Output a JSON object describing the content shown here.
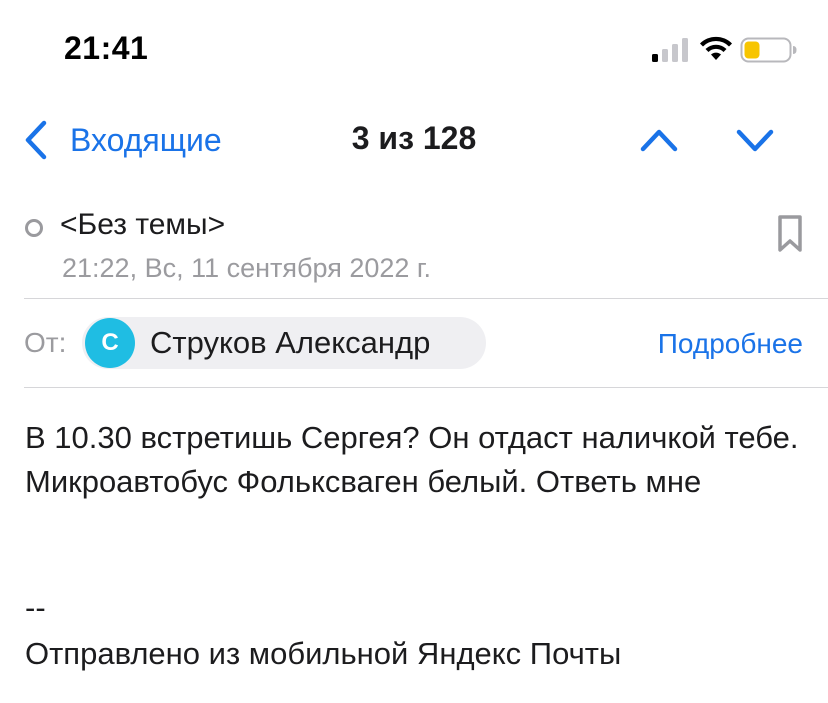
{
  "status_bar": {
    "time": "21:41",
    "signal_icon": "cellular-signal-icon",
    "wifi_icon": "wifi-icon",
    "battery_icon": "battery-low-icon",
    "battery_color": "#f7c500"
  },
  "nav": {
    "back_label": "Входящие",
    "counter": "3 из 128",
    "accent_color": "#1a73e8"
  },
  "message": {
    "subject": "<Без темы>",
    "date": "21:22, Вс, 11 сентября 2022 г.",
    "from_label": "От:",
    "sender_initial": "С",
    "sender_name": "Струков Александр",
    "avatar_color": "#1fbde3",
    "details_label": "Подробнее",
    "body": "В 10.30 встретишь Сергея? Он отдаст наличкой тебе. Микроавтобус Фольксваген белый. Ответь мне",
    "signature_separator": "--",
    "signature": "Отправлено из мобильной Яндекс Почты"
  }
}
